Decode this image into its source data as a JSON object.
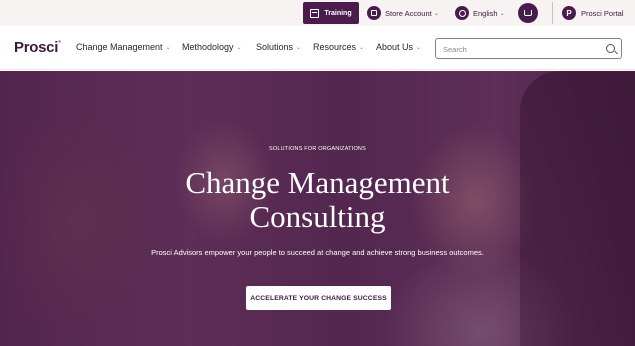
{
  "utility": {
    "training_label": "Training",
    "store_label": "Store Account",
    "language_label": "English",
    "portal_label": "Prosci Portal",
    "portal_glyph": "P"
  },
  "nav": {
    "logo": "Prosci",
    "items": [
      {
        "label": "Change Management"
      },
      {
        "label": "Methodology"
      },
      {
        "label": "Solutions"
      },
      {
        "label": "Resources"
      },
      {
        "label": "About Us"
      }
    ],
    "search_placeholder": "Search"
  },
  "hero": {
    "eyebrow": "SOLUTIONS FOR ORGANIZATIONS",
    "title_line1": "Change Management",
    "title_line2": "Consulting",
    "subtitle": "Prosci Advisors empower your people to succeed at change and achieve strong business outcomes.",
    "cta_label": "ACCELERATE YOUR CHANGE SUCCESS"
  },
  "colors": {
    "brand_purple": "#4a1c4e",
    "utility_bg": "#f6f3f2",
    "hero_overlay": "#5a2d55"
  },
  "icons": [
    "calendar-icon",
    "store-icon",
    "globe-icon",
    "cart-icon",
    "portal-icon",
    "search-icon",
    "chevron-down-icon"
  ]
}
